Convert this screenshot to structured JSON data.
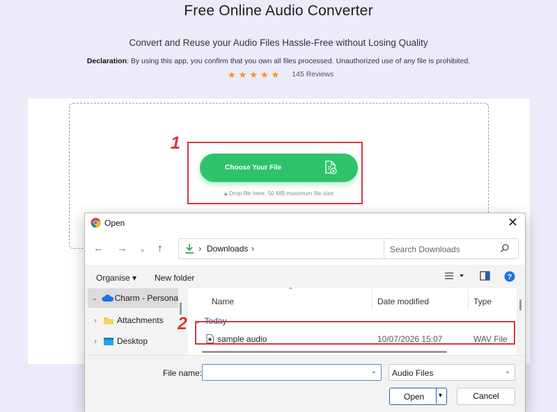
{
  "page": {
    "title": "Free Online Audio Converter",
    "subtitle": "Convert and Reuse your Audio Files Hassle-Free without Losing Quality",
    "declaration_label": "Declaration",
    "declaration_text": ": By using this app, you confirm that you own all files processed. Unauthorized use of any file is prohibited.",
    "rating_stars": 5,
    "reviews": "145 Reviews"
  },
  "upload": {
    "choose_label": "Choose Your File",
    "drop_hint": "Drop file here. 50 MB maximum file size",
    "callout_1": "1",
    "callout_2": "2"
  },
  "dialog": {
    "title": "Open",
    "address_crumb": "Downloads",
    "search_placeholder": "Search Downloads",
    "toolbar": {
      "organise": "Organise ▾",
      "new_folder": "New folder"
    },
    "nav_items": [
      {
        "label": "Charm - Persona",
        "icon": "cloud-icon"
      },
      {
        "label": "Attachments",
        "icon": "folder-icon"
      },
      {
        "label": "Desktop",
        "icon": "desktop-folder-icon"
      }
    ],
    "columns": {
      "name": "Name",
      "date": "Date modified",
      "type": "Type"
    },
    "group": "Today",
    "files": [
      {
        "name": "sample audio",
        "date": "10/07/2026 15:07",
        "type": "WAV File"
      }
    ],
    "file_name_label": "File name:",
    "file_name_value": "",
    "file_type": "Audio Files",
    "open_label": "Open",
    "cancel_label": "Cancel"
  },
  "colors": {
    "accent_green": "#2ec36a",
    "callout_red": "#d9363e",
    "star_orange": "#ff8a1f"
  }
}
